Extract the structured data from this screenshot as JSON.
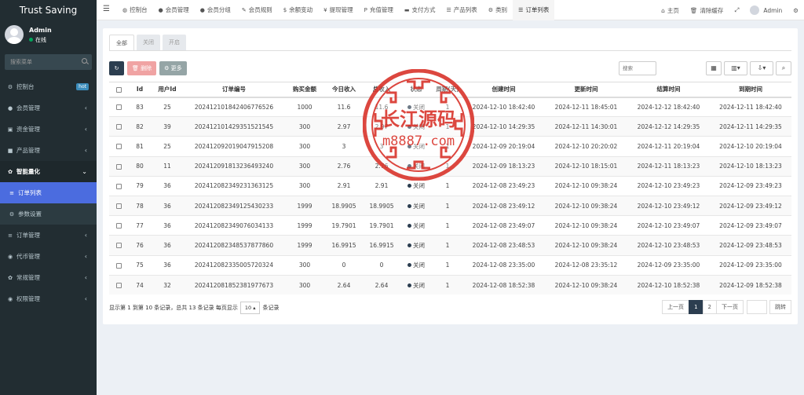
{
  "brand": "Trust Saving",
  "user": {
    "name": "Admin",
    "status": "在线"
  },
  "sidebar": {
    "search_placeholder": "搜索菜单",
    "items": [
      {
        "label": "控制台",
        "icon": "dashboard-icon",
        "glyph": "⚙",
        "badge": "hot"
      },
      {
        "label": "会员管理",
        "icon": "user-icon",
        "glyph": "●",
        "chevron": "‹"
      },
      {
        "label": "资金管理",
        "icon": "money-icon",
        "glyph": "▣",
        "chevron": "‹"
      },
      {
        "label": "产品管理",
        "icon": "product-icon",
        "glyph": "■",
        "chevron": "‹"
      },
      {
        "label": "智能量化",
        "icon": "gear-icon",
        "glyph": "✿",
        "chevron": "⌄"
      },
      {
        "label": "订单列表",
        "icon": "list-icon",
        "glyph": "≡"
      },
      {
        "label": "参数设置",
        "icon": "settings-icon",
        "glyph": "⚙"
      },
      {
        "label": "订单管理",
        "icon": "order-icon",
        "glyph": "≡",
        "chevron": "‹"
      },
      {
        "label": "代币管理",
        "icon": "token-icon",
        "glyph": "◉",
        "chevron": "‹"
      },
      {
        "label": "常规管理",
        "icon": "cogs-icon",
        "glyph": "✿",
        "chevron": "‹"
      },
      {
        "label": "权限管理",
        "icon": "permission-icon",
        "glyph": "◉",
        "chevron": "‹"
      }
    ]
  },
  "topbar": {
    "tabs": [
      {
        "label": "控制台",
        "glyph": "◍"
      },
      {
        "label": "会员管理",
        "glyph": "●"
      },
      {
        "label": "会员分组",
        "glyph": "●"
      },
      {
        "label": "会员规则",
        "glyph": "✎"
      },
      {
        "label": "余额变动",
        "glyph": "$"
      },
      {
        "label": "提现管理",
        "glyph": "¥"
      },
      {
        "label": "充值管理",
        "glyph": "P"
      },
      {
        "label": "支付方式",
        "glyph": "▬"
      },
      {
        "label": "产品列表",
        "glyph": "☰"
      },
      {
        "label": "类别",
        "glyph": "⚙"
      },
      {
        "label": "订单列表",
        "glyph": "☰"
      }
    ],
    "right": {
      "home": "主页",
      "clear_cache": "清除缓存",
      "user": "Admin"
    }
  },
  "subtabs": [
    "全部",
    "关闭",
    "开启"
  ],
  "toolbar": {
    "delete": "删除",
    "more": "更多",
    "search_placeholder": "搜索"
  },
  "table": {
    "headers": [
      "Id",
      "用户Id",
      "订单编号",
      "购买金额",
      "今日收入",
      "总收入",
      "状态",
      "周期(天)",
      "创建时间",
      "更新时间",
      "结算时间",
      "到期时间"
    ],
    "rows": [
      [
        "83",
        "25",
        "202412101842406776526",
        "1000",
        "11.6",
        "11.6",
        "关闭",
        "1",
        "2024-12-10 18:42:40",
        "2024-12-11 18:45:01",
        "2024-12-12 18:42:40",
        "2024-12-11 18:42:40"
      ],
      [
        "82",
        "39",
        "202412101429351521545",
        "300",
        "2.97",
        "2.97",
        "关闭",
        "1",
        "2024-12-10 14:29:35",
        "2024-12-11 14:30:01",
        "2024-12-12 14:29:35",
        "2024-12-11 14:29:35"
      ],
      [
        "81",
        "25",
        "202412092019047915208",
        "300",
        "3",
        "3",
        "关闭",
        "1",
        "2024-12-09 20:19:04",
        "2024-12-10 20:20:02",
        "2024-12-11 20:19:04",
        "2024-12-10 20:19:04"
      ],
      [
        "80",
        "11",
        "202412091813236493240",
        "300",
        "2.76",
        "2.76",
        "关闭",
        "1",
        "2024-12-09 18:13:23",
        "2024-12-10 18:15:01",
        "2024-12-11 18:13:23",
        "2024-12-10 18:13:23"
      ],
      [
        "79",
        "36",
        "202412082349231363125",
        "300",
        "2.91",
        "2.91",
        "关闭",
        "1",
        "2024-12-08 23:49:23",
        "2024-12-10 09:38:24",
        "2024-12-10 23:49:23",
        "2024-12-09 23:49:23"
      ],
      [
        "78",
        "36",
        "202412082349125430233",
        "1999",
        "18.9905",
        "18.9905",
        "关闭",
        "1",
        "2024-12-08 23:49:12",
        "2024-12-10 09:38:24",
        "2024-12-10 23:49:12",
        "2024-12-09 23:49:12"
      ],
      [
        "77",
        "36",
        "202412082349076034133",
        "1999",
        "19.7901",
        "19.7901",
        "关闭",
        "1",
        "2024-12-08 23:49:07",
        "2024-12-10 09:38:24",
        "2024-12-10 23:49:07",
        "2024-12-09 23:49:07"
      ],
      [
        "76",
        "36",
        "202412082348537877860",
        "1999",
        "16.9915",
        "16.9915",
        "关闭",
        "1",
        "2024-12-08 23:48:53",
        "2024-12-10 09:38:24",
        "2024-12-10 23:48:53",
        "2024-12-09 23:48:53"
      ],
      [
        "75",
        "36",
        "202412082335005720324",
        "300",
        "0",
        "0",
        "关闭",
        "1",
        "2024-12-08 23:35:00",
        "2024-12-08 23:35:12",
        "2024-12-09 23:35:00",
        "2024-12-09 23:35:00"
      ],
      [
        "74",
        "32",
        "202412081852381977673",
        "300",
        "2.64",
        "2.64",
        "关闭",
        "1",
        "2024-12-08 18:52:38",
        "2024-12-10 09:38:24",
        "2024-12-10 18:52:38",
        "2024-12-09 18:52:38"
      ]
    ]
  },
  "footer": {
    "info_prefix": "显示第 1 到第 10 条记录，总共 13 条记录 每页显示",
    "page_size": "10",
    "info_suffix": "条记录",
    "prev": "上一页",
    "pages": [
      "1",
      "2"
    ],
    "next": "下一页",
    "jump": "跳转"
  },
  "watermark": {
    "line1": "长江源码",
    "line2": "m8887.com"
  },
  "colors": {
    "sidebar": "#222d32",
    "active_menu": "#4b6cdf",
    "stamp": "#d9342b",
    "primary": "#2c3e50"
  }
}
